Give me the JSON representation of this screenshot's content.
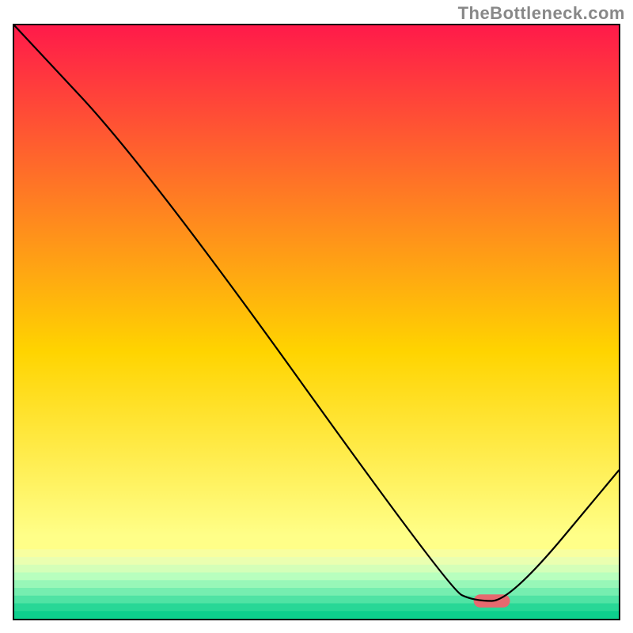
{
  "watermark": "TheBottleneck.com",
  "chart_data": {
    "type": "line",
    "title": "",
    "xlabel": "",
    "ylabel": "",
    "xlim": [
      0,
      100
    ],
    "ylim": [
      0,
      100
    ],
    "x": [
      0,
      22,
      72,
      76,
      82,
      100
    ],
    "values": [
      100,
      76,
      5,
      3,
      3,
      25
    ],
    "marker": {
      "x": 79,
      "y": 3,
      "width": 6,
      "height": 2.2,
      "color": "#e6696f"
    },
    "background_gradient": {
      "top_color": "#ff1a4a",
      "mid_color": "#ffd400",
      "bottom_main_color": "#ffff88",
      "bands_start_y_pct": 87,
      "bands": [
        "#ffff88",
        "#f8ffa0",
        "#eaffb0",
        "#d4ffb8",
        "#b8ffbe",
        "#98f7b8",
        "#76eeb0",
        "#50e3a4",
        "#28d796",
        "#0dcf8d"
      ]
    }
  }
}
